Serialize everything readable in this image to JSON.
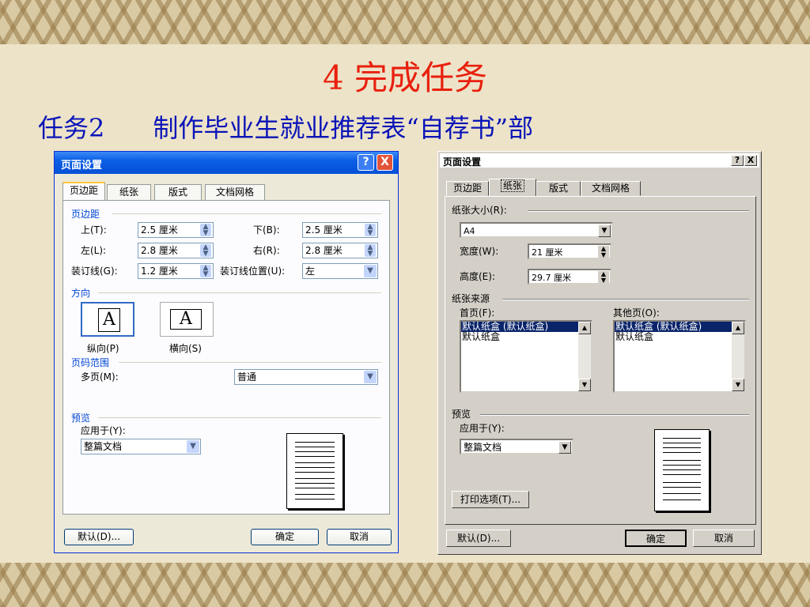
{
  "slide": {
    "title": "4 完成任务",
    "subtitle": "任务2      制作毕业生就业推荐表“自荐书”部"
  },
  "xp_dialog": {
    "title": "页面设置",
    "help_label": "?",
    "close_label": "X",
    "tabs": [
      "页边距",
      "纸张",
      "版式",
      "文档网格"
    ],
    "margins_section": "页边距",
    "top_label": "上(T):",
    "top_value": "2.5 厘米",
    "bottom_label": "下(B):",
    "bottom_value": "2.5 厘米",
    "left_label": "左(L):",
    "left_value": "2.8 厘米",
    "right_label": "右(R):",
    "right_value": "2.8 厘米",
    "gutter_label": "装订线(G):",
    "gutter_value": "1.2 厘米",
    "gutter_pos_label": "装订线位置(U):",
    "gutter_pos_value": "左",
    "orientation_section": "方向",
    "portrait_label": "纵向(P)",
    "landscape_label": "横向(S)",
    "orientation_glyph": "A",
    "pages_section": "页码范围",
    "multiple_pages_label": "多页(M):",
    "multiple_pages_value": "普通",
    "preview_section": "预览",
    "apply_to_label": "应用于(Y):",
    "apply_to_value": "整篇文档",
    "default_button": "默认(D)...",
    "ok_button": "确定",
    "cancel_button": "取消"
  },
  "classic_dialog": {
    "title": "页面设置",
    "help_label": "?",
    "close_label": "X",
    "tabs": [
      "页边距",
      "纸张",
      "版式",
      "文档网格"
    ],
    "paper_size_label": "纸张大小(R):",
    "paper_size_value": "A4",
    "width_label": "宽度(W):",
    "width_value": "21 厘米",
    "height_label": "高度(E):",
    "height_value": "29.7 厘米",
    "paper_source_label": "纸张来源",
    "first_page_label": "首页(F):",
    "other_pages_label": "其他页(O):",
    "source_items": [
      "默认纸盒 (默认纸盒)",
      "默认纸盒"
    ],
    "preview_label": "预览",
    "apply_to_label": "应用于(Y):",
    "apply_to_value": "整篇文档",
    "print_options_button": "打印选项(T)...",
    "default_button": "默认(D)...",
    "ok_button": "确定",
    "cancel_button": "取消"
  },
  "colors": {
    "title_red": "#e8200e",
    "subtitle_blue": "#0a14b8",
    "xp_titlebar": "#0a5ee5",
    "selection": "#0a246a"
  }
}
